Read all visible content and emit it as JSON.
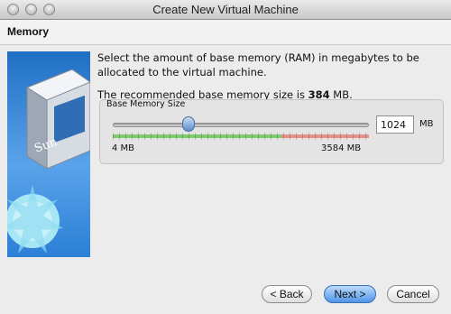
{
  "window": {
    "title": "Create New Virtual Machine"
  },
  "header": {
    "title": "Memory"
  },
  "content": {
    "description": "Select the amount of base memory (RAM) in megabytes to be allocated to the virtual machine.",
    "recommended_prefix": "The recommended base memory size is ",
    "recommended_value": "384",
    "recommended_unit": " MB."
  },
  "memory_group": {
    "label": "Base Memory Size",
    "value": "1024",
    "unit": "MB",
    "min_label": "4 MB",
    "max_label": "3584 MB",
    "slider": {
      "min": 4,
      "max": 3584,
      "value": 1024,
      "recommended_max_fraction": 0.66
    }
  },
  "buttons": {
    "back": "< Back",
    "next": "Next >",
    "cancel": "Cancel"
  },
  "icons": {
    "side_image": "virtualbox-logo-image"
  },
  "colors": {
    "accent": "#4f95e6",
    "green": "#7ecb6a",
    "red": "#e6918a"
  }
}
